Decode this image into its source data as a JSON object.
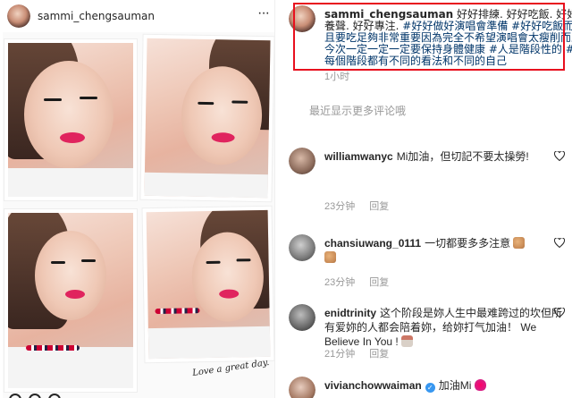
{
  "post": {
    "username": "sammi_chengsauman",
    "more_label": "···"
  },
  "collage": {
    "signature": "Love a great day."
  },
  "caption": {
    "username": "sammi_chengsauman",
    "text_1": " 好好排練. 好好吃飯. 好好養聲. 好好專注. ",
    "tag_1": "#好好做好演唱會準備",
    "text_2": " ",
    "tag_2": "#好好吃飯而且要吃足夠非常重要因為完全不希望演唱會太瘦削而且今次一定一定一定要保持身體健康",
    "text_3": " ",
    "tag_3": "#人是階段性的",
    "text_4": " ",
    "tag_4": "#每個階段都有不同的看法和不同的自己",
    "time": "1小时"
  },
  "view_more": "最近显示更多评论哦",
  "comments": [
    {
      "username": "williamwanyc",
      "text": "Mi加油，但切記不要太操勞!",
      "time": "23分钟",
      "reply": "回复"
    },
    {
      "username": "chansiuwang_0111",
      "text": "一切都要多多注意",
      "time": "23分钟",
      "reply": "回复"
    },
    {
      "username": "enidtrinity",
      "text": "这个阶段是妳人生中最难跨过的坎但所有爱妳的人都会陪着妳，给妳打气加油！ We Believe In You !",
      "time": "21分钟",
      "reply": "回复"
    },
    {
      "username": "vivianchowwaiman",
      "text": "加油Mi",
      "time": "",
      "reply": ""
    }
  ],
  "colors": {
    "highlight_box": "#e8101e",
    "hashtag": "#003569",
    "verified": "#3897f0"
  }
}
